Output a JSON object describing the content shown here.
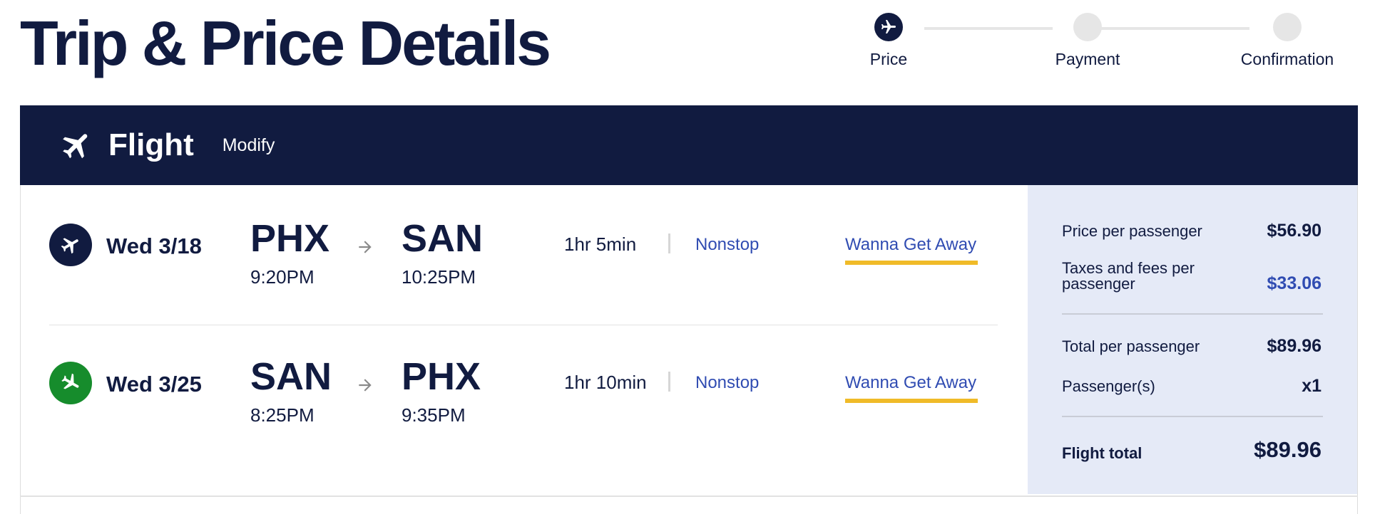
{
  "page": {
    "title": "Trip & Price Details"
  },
  "stepper": {
    "steps": [
      {
        "label": "Price",
        "active": true,
        "icon": "airplane-icon"
      },
      {
        "label": "Payment",
        "active": false
      },
      {
        "label": "Confirmation",
        "active": false
      }
    ]
  },
  "flight_bar": {
    "title": "Flight",
    "modify_label": "Modify",
    "icon": "airplane-icon"
  },
  "legs": [
    {
      "date": "Wed 3/18",
      "depart_airport": "PHX",
      "depart_time": "9:20PM",
      "arrive_airport": "SAN",
      "arrive_time": "10:25PM",
      "duration": "1hr 5min",
      "stops": "Nonstop",
      "fare": "Wanna Get Away",
      "icon_color": "#111b40"
    },
    {
      "date": "Wed 3/25",
      "depart_airport": "SAN",
      "depart_time": "8:25PM",
      "arrive_airport": "PHX",
      "arrive_time": "9:35PM",
      "duration": "1hr 10min",
      "stops": "Nonstop",
      "fare": "Wanna Get Away",
      "icon_color": "#168c2c"
    }
  ],
  "price_summary": {
    "price_per_passenger_label": "Price per passenger",
    "price_per_passenger": "$56.90",
    "taxes_label_line1": "Taxes and fees per",
    "taxes_label_line2": "passenger",
    "taxes": "$33.06",
    "total_per_passenger_label": "Total per passenger",
    "total_per_passenger": "$89.96",
    "passengers_label": "Passenger(s)",
    "passengers": "x1",
    "flight_total_label": "Flight total",
    "flight_total": "$89.96"
  },
  "colors": {
    "navy": "#111b40",
    "link_blue": "#304cb2",
    "fare_underline": "#f0bb28",
    "panel_bg": "#e5eaf7",
    "return_icon": "#168c2c"
  }
}
